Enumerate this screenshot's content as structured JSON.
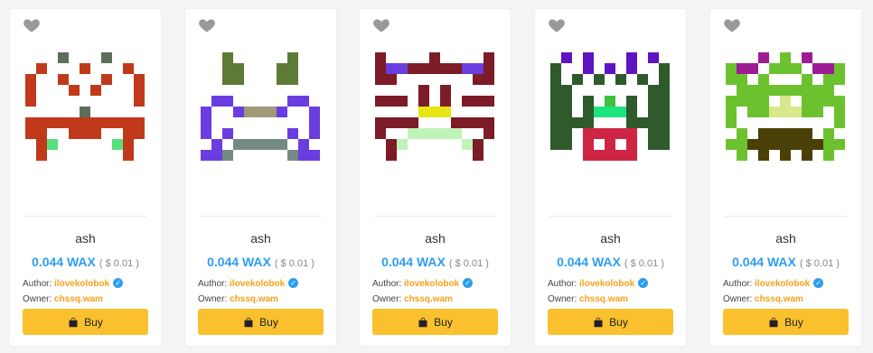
{
  "colors": {
    "accent_blue": "#2e9df0",
    "author_orange": "#f5a21a",
    "buy_yellow": "#fbc02d",
    "heart_gray": "#999999"
  },
  "cards": [
    {
      "name": "ash",
      "price": "0.044 WAX",
      "usd": "( $ 0.01 )",
      "author_label": "Author:",
      "author": "ilovekolobok",
      "owner_label": "Owner:",
      "owner": "chssq.wam",
      "buy_label": "Buy",
      "icons": [
        "heart-icon",
        "verified-icon",
        "shopping-bag-icon"
      ]
    },
    {
      "name": "ash",
      "price": "0.044 WAX",
      "usd": "( $ 0.01 )",
      "author_label": "Author:",
      "author": "ilovekolobok",
      "owner_label": "Owner:",
      "owner": "chssq.wam",
      "buy_label": "Buy",
      "icons": [
        "heart-icon",
        "verified-icon",
        "shopping-bag-icon"
      ]
    },
    {
      "name": "ash",
      "price": "0.044 WAX",
      "usd": "( $ 0.01 )",
      "author_label": "Author:",
      "author": "ilovekolobok",
      "owner_label": "Owner:",
      "owner": "chssq.wam",
      "buy_label": "Buy",
      "icons": [
        "heart-icon",
        "verified-icon",
        "shopping-bag-icon"
      ]
    },
    {
      "name": "ash",
      "price": "0.044 WAX",
      "usd": "( $ 0.01 )",
      "author_label": "Author:",
      "author": "ilovekolobok",
      "owner_label": "Owner:",
      "owner": "chssq.wam",
      "buy_label": "Buy",
      "icons": [
        "heart-icon",
        "verified-icon",
        "shopping-bag-icon"
      ]
    },
    {
      "name": "ash",
      "price": "0.044 WAX",
      "usd": "( $ 0.01 )",
      "author_label": "Author:",
      "author": "ilovekolobok",
      "owner_label": "Owner:",
      "owner": "chssq.wam",
      "buy_label": "Buy",
      "icons": [
        "heart-icon",
        "verified-icon",
        "shopping-bag-icon"
      ]
    }
  ]
}
